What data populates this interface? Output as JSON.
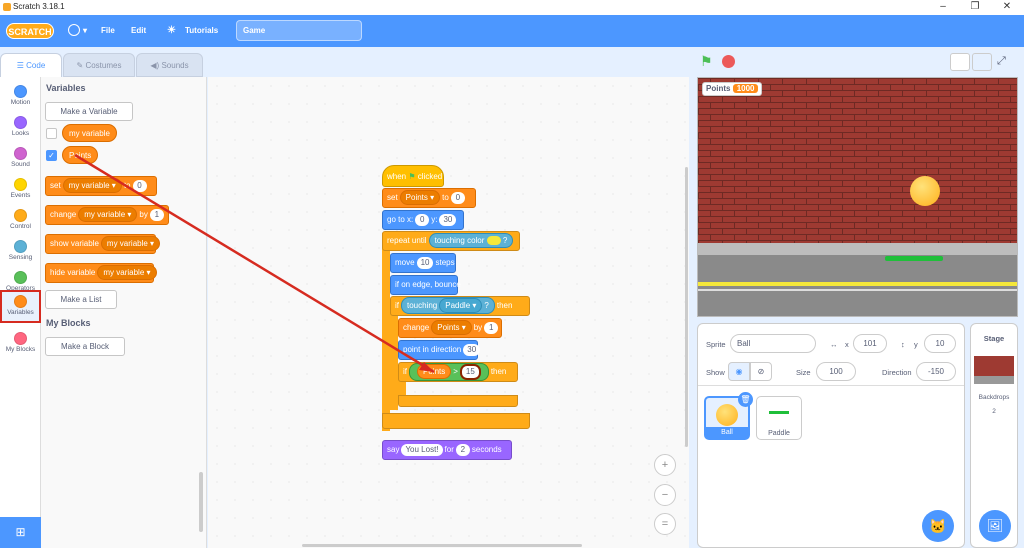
{
  "window": {
    "title": "Scratch 3.18.1"
  },
  "menubar": {
    "logo": "SCRATCH",
    "file": "File",
    "edit": "Edit",
    "tutorials": "Tutorials",
    "project_title": "Game"
  },
  "tabs": {
    "code": "Code",
    "costumes": "Costumes",
    "sounds": "Sounds"
  },
  "categories": [
    {
      "label": "Motion",
      "color": "#4c97ff"
    },
    {
      "label": "Looks",
      "color": "#9966ff"
    },
    {
      "label": "Sound",
      "color": "#cf63cf"
    },
    {
      "label": "Events",
      "color": "#ffd500"
    },
    {
      "label": "Control",
      "color": "#ffab19"
    },
    {
      "label": "Sensing",
      "color": "#5cb1d6"
    },
    {
      "label": "Operators",
      "color": "#59c059"
    },
    {
      "label": "Variables",
      "color": "#ff8c1a"
    },
    {
      "label": "My Blocks",
      "color": "#ff6680"
    }
  ],
  "flyout": {
    "variables_heading": "Variables",
    "make_variable": "Make a Variable",
    "var1": "my variable",
    "var2": "Points",
    "set_block": {
      "verb": "set",
      "var": "my variable",
      "to": "to",
      "value": "0"
    },
    "change_block": {
      "verb": "change",
      "var": "my variable",
      "by": "by",
      "value": "1"
    },
    "show_block": {
      "verb": "show variable",
      "var": "my variable"
    },
    "hide_block": {
      "verb": "hide variable",
      "var": "my variable"
    },
    "make_list": "Make a List",
    "myblocks_heading": "My Blocks",
    "make_block": "Make a Block"
  },
  "script": {
    "hat": {
      "when": "when",
      "clicked": "clicked"
    },
    "set": {
      "verb": "set",
      "var": "Points",
      "to": "to",
      "value": "0"
    },
    "goto": {
      "label": "go to x:",
      "x": "0",
      "ylabel": "y:",
      "y": "30"
    },
    "repeat_until": {
      "label": "repeat until",
      "cond": "touching color",
      "q": "?"
    },
    "move": {
      "label": "move",
      "value": "10",
      "unit": "steps"
    },
    "bounce": {
      "label": "if on edge, bounce"
    },
    "if1": {
      "if": "if",
      "cond": "touching",
      "target": "Paddle",
      "q": "?",
      "then": "then"
    },
    "change": {
      "verb": "change",
      "var": "Points",
      "by": "by",
      "value": "1"
    },
    "point": {
      "label": "point in direction",
      "value": "30"
    },
    "if2": {
      "if": "if",
      "var": "Points",
      "op": ">",
      "value": "15",
      "then": "then"
    },
    "say": {
      "label": "say",
      "msg": "You Lost!",
      "for": "for",
      "secs": "2",
      "unit": "seconds"
    }
  },
  "stage": {
    "monitor_label": "Points",
    "monitor_value": "1000"
  },
  "sprite_info": {
    "sprite_label": "Sprite",
    "sprite_name": "Ball",
    "x_label": "x",
    "x": "101",
    "y_label": "y",
    "y": "10",
    "show_label": "Show",
    "size_label": "Size",
    "size": "100",
    "direction_label": "Direction",
    "direction": "-150"
  },
  "sprites": [
    {
      "name": "Ball"
    },
    {
      "name": "Paddle"
    }
  ],
  "stage_panel": {
    "title": "Stage",
    "backdrops_label": "Backdrops",
    "backdrops_count": "2"
  }
}
